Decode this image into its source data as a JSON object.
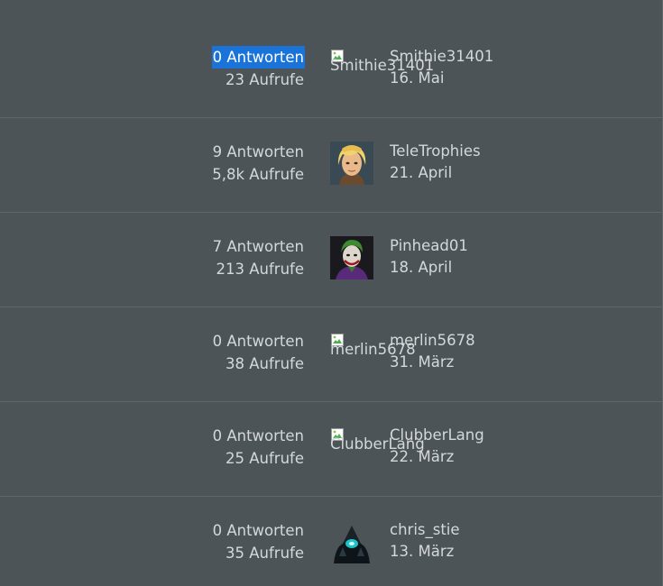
{
  "topics": [
    {
      "replies": "0 Antworten",
      "views": "23 Aufrufe",
      "replies_selected": true,
      "avatar": {
        "type": "broken",
        "alt": "Smithie31401"
      },
      "poster": "Smithie31401",
      "date": "16. Mai"
    },
    {
      "replies": "9 Antworten",
      "views": "5,8k Aufrufe",
      "replies_selected": false,
      "avatar": {
        "type": "portrait-blond-hero"
      },
      "poster": "TeleTrophies",
      "date": "21. April"
    },
    {
      "replies": "7 Antworten",
      "views": "213 Aufrufe",
      "replies_selected": false,
      "avatar": {
        "type": "portrait-joker"
      },
      "poster": "Pinhead01",
      "date": "18. April"
    },
    {
      "replies": "0 Antworten",
      "views": "38 Aufrufe",
      "replies_selected": false,
      "avatar": {
        "type": "broken",
        "alt": "merlin5678"
      },
      "poster": "merlin5678",
      "date": "31. März"
    },
    {
      "replies": "0 Antworten",
      "views": "25 Aufrufe",
      "replies_selected": false,
      "avatar": {
        "type": "broken",
        "alt": "ClubberLang"
      },
      "poster": "ClubberLang",
      "date": "22. März"
    },
    {
      "replies": "0 Antworten",
      "views": "35 Aufrufe",
      "replies_selected": false,
      "avatar": {
        "type": "portrait-dark-knight"
      },
      "poster": "chris_stie",
      "date": "13. März"
    }
  ],
  "colors": {
    "background": "#4d5457",
    "divider": "#5f666a",
    "text": "#d4d8da",
    "selection": "#1a73d9"
  }
}
